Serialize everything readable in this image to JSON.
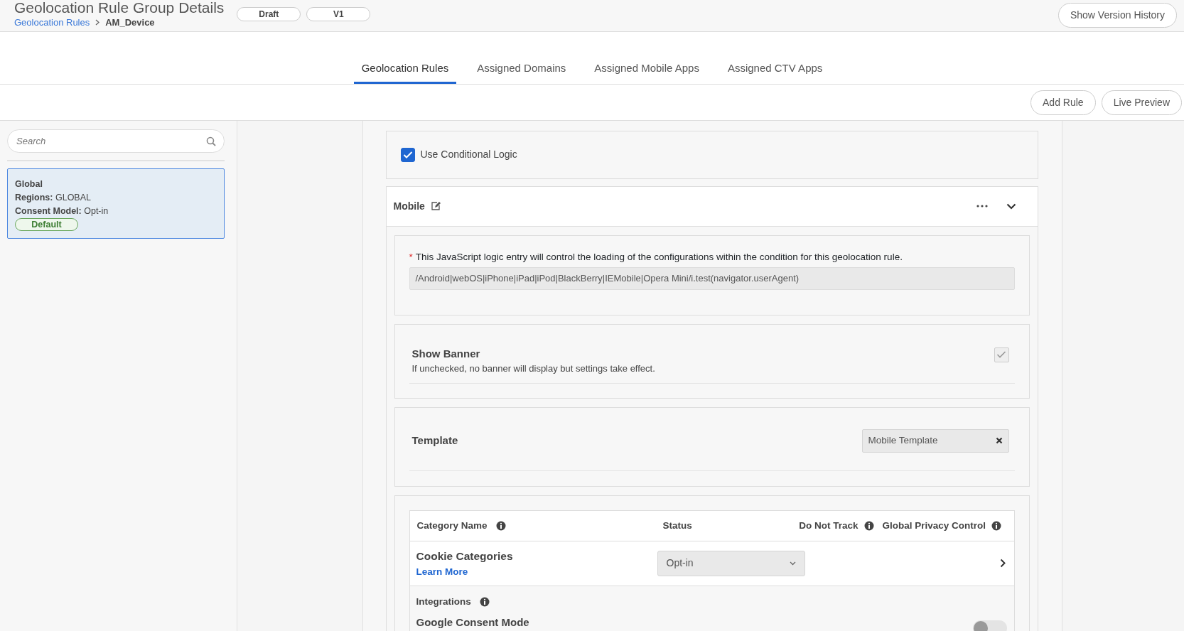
{
  "header": {
    "title": "Geolocation Rule Group Details",
    "breadcrumb": [
      {
        "label": "Geolocation Rules",
        "kind": "link"
      },
      {
        "label": "AM_Device",
        "kind": "current"
      }
    ],
    "badges": [
      "Draft",
      "V1"
    ],
    "version_button": "Show Version History"
  },
  "tabs": [
    {
      "label": "Geolocation Rules",
      "selected": true
    },
    {
      "label": "Assigned Domains",
      "selected": false
    },
    {
      "label": "Assigned Mobile Apps",
      "selected": false
    },
    {
      "label": "Assigned CTV Apps",
      "selected": false
    }
  ],
  "toolbar": [
    "Add Rule",
    "Live Preview"
  ],
  "sidebar": {
    "search": {
      "placeholder": "Search"
    },
    "rules": [
      {
        "name": "Global",
        "regions_label": "Regions:",
        "regions": "GLOBAL",
        "consent_label": "Consent Model:",
        "consent": "Opt-in",
        "badge": "Default",
        "selected": true
      }
    ]
  },
  "rule": {
    "conditional_logic": {
      "label": "Use Conditional Logic",
      "checked": true
    },
    "condition": {
      "name": "Mobile",
      "expanded": true
    },
    "logic": {
      "required_mark": "*",
      "label": "This JavaScript logic entry will control the loading of the configurations within the condition for this geolocation rule.",
      "value": "/Android|webOS|iPhone|iPad|iPod|BlackBerry|IEMobile|Opera Mini/i.test(navigator.userAgent)"
    },
    "show_banner": {
      "title": "Show Banner",
      "description": "If unchecked, no banner will display but settings take effect.",
      "checked": true,
      "disabled": true
    },
    "template": {
      "label": "Template",
      "value": "Mobile Template"
    },
    "categories_table": {
      "columns": [
        {
          "label": "Category Name",
          "info": true
        },
        {
          "label": "Status",
          "info": false
        },
        {
          "label": "Do Not Track",
          "info": true
        },
        {
          "label": "Global Privacy Control",
          "info": true
        }
      ],
      "rows": [
        {
          "name": "Cookie Categories",
          "link": "Learn More",
          "status": "Opt-in"
        }
      ]
    },
    "integrations": {
      "label": "Integrations",
      "info": true,
      "items": [
        {
          "name": "Google Consent Mode",
          "on": false
        }
      ]
    }
  }
}
